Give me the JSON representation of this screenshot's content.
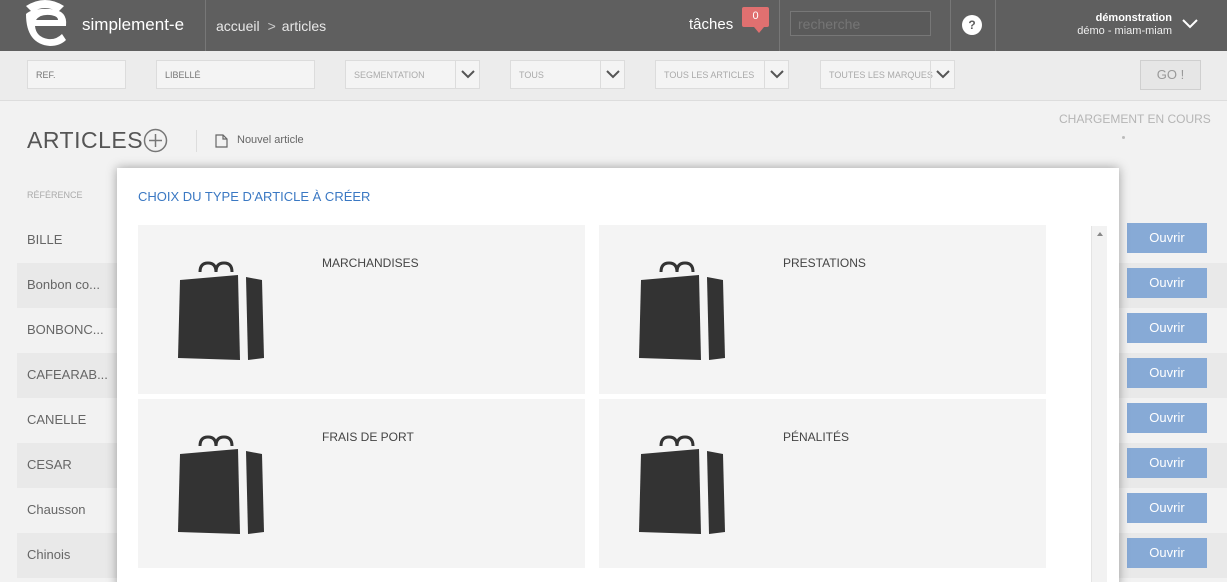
{
  "header": {
    "brand": "simplement-e",
    "breadcrumb": [
      "accueil",
      "articles"
    ],
    "breadcrumb_sep": ">",
    "tasks_label": "tâches",
    "tasks_count": "0",
    "search_placeholder": "recherche",
    "help": "?",
    "user_name": "démonstration",
    "user_company": "démo - miam-miam"
  },
  "filters": {
    "ref_placeholder": "REF.",
    "libelle_placeholder": "LIBELLÉ",
    "segmentation": "SEGMENTATION",
    "tous": "TOUS",
    "tous_articles": "TOUS LES ARTICLES",
    "toutes_marques": "TOUTES LES MARQUES",
    "go": "GO !"
  },
  "page": {
    "title": "ARTICLES",
    "new_article": "Nouvel article",
    "loading": "CHARGEMENT EN COURS",
    "column_reference": "RÉFÉRENCE"
  },
  "rows": [
    {
      "ref": "BILLE",
      "action": "Ouvrir"
    },
    {
      "ref": "Bonbon co...",
      "action": "Ouvrir"
    },
    {
      "ref": "BONBONC...",
      "action": "Ouvrir"
    },
    {
      "ref": "CAFEARAB...",
      "action": "Ouvrir"
    },
    {
      "ref": "CANELLE",
      "action": "Ouvrir"
    },
    {
      "ref": "CESAR",
      "action": "Ouvrir"
    },
    {
      "ref": "Chausson",
      "action": "Ouvrir"
    },
    {
      "ref": "Chinois",
      "action": "Ouvrir"
    }
  ],
  "modal": {
    "title": "CHOIX DU TYPE D'ARTICLE À CRÉER",
    "cards": [
      {
        "label": "MARCHANDISES",
        "icon": "shopping-bag-icon"
      },
      {
        "label": "PRESTATIONS",
        "icon": "shopping-bag-icon"
      },
      {
        "label": "FRAIS DE PORT",
        "icon": "shopping-bag-icon"
      },
      {
        "label": "PÉNALITÉS",
        "icon": "shopping-bag-icon"
      }
    ]
  },
  "colors": {
    "topbar": "#5f5f5f",
    "accent_blue": "#3a78c3",
    "button_blue": "#87aad6",
    "badge_red": "#e07070"
  }
}
